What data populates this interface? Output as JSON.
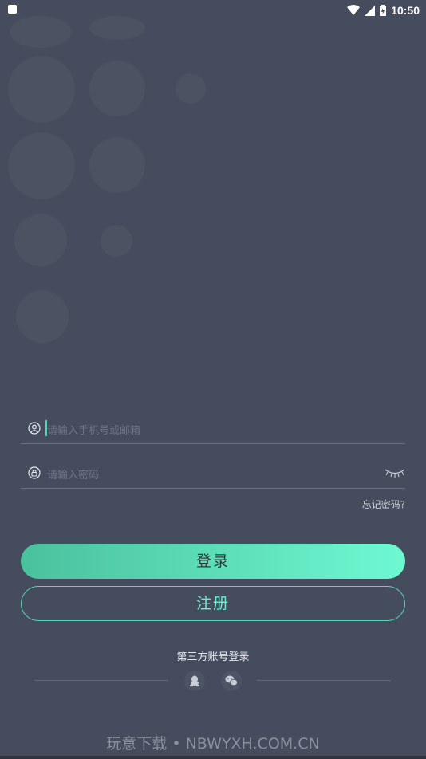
{
  "status_bar": {
    "time": "10:50"
  },
  "login_form": {
    "account_placeholder": "请输入手机号或邮箱",
    "password_placeholder": "请输入密码",
    "forgot_password": "忘记密码?"
  },
  "buttons": {
    "login": "登录",
    "register": "注册"
  },
  "third_party": {
    "title": "第三方账号登录",
    "icons": [
      "qq-icon",
      "wechat-icon"
    ]
  },
  "watermark": "玩意下载 • NBWYXH.COM.CN",
  "colors": {
    "background": "#454c5d",
    "accent_start": "#4ac19d",
    "accent_end": "#6ef9d2",
    "border_accent": "#5ad6b6"
  }
}
